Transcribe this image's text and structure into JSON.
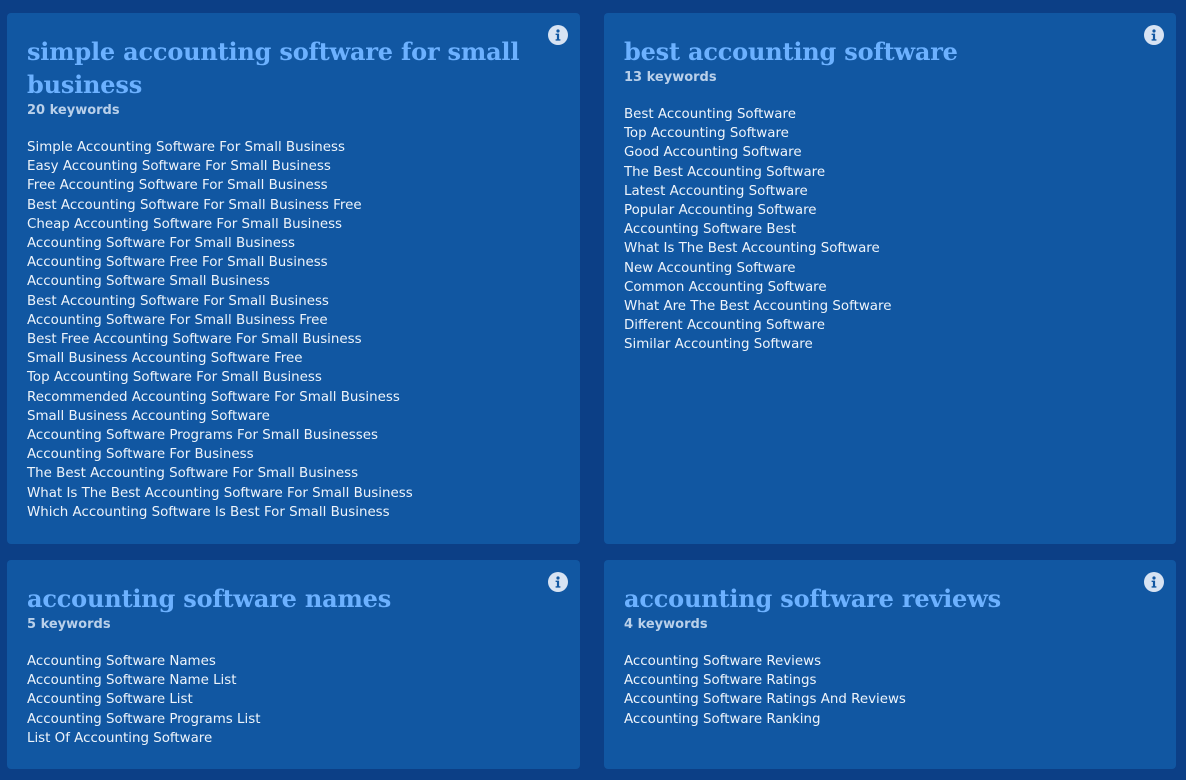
{
  "cards": [
    {
      "title": "simple accounting software for small business",
      "count": "20 keywords",
      "keywords": [
        "Simple Accounting Software For Small Business",
        "Easy Accounting Software For Small Business",
        "Free Accounting Software For Small Business",
        "Best Accounting Software For Small Business Free",
        "Cheap Accounting Software For Small Business",
        "Accounting Software For Small Business",
        "Accounting Software Free For Small Business",
        "Accounting Software Small Business",
        "Best Accounting Software For Small Business",
        "Accounting Software For Small Business Free",
        "Best Free Accounting Software For Small Business",
        "Small Business Accounting Software Free",
        "Top Accounting Software For Small Business",
        "Recommended Accounting Software For Small Business",
        "Small Business Accounting Software",
        "Accounting Software Programs For Small Businesses",
        "Accounting Software For Business",
        "The Best Accounting Software For Small Business",
        "What Is The Best Accounting Software For Small Business",
        "Which Accounting Software Is Best For Small Business"
      ]
    },
    {
      "title": "best accounting software",
      "count": "13 keywords",
      "keywords": [
        "Best Accounting Software",
        "Top Accounting Software",
        "Good Accounting Software",
        "The Best Accounting Software",
        "Latest Accounting Software",
        "Popular Accounting Software",
        "Accounting Software Best",
        "What Is The Best Accounting Software",
        "New Accounting Software",
        "Common Accounting Software",
        "What Are The Best Accounting Software",
        "Different Accounting Software",
        "Similar Accounting Software"
      ]
    },
    {
      "title": "accounting software names",
      "count": "5 keywords",
      "keywords": [
        "Accounting Software Names",
        "Accounting Software Name List",
        "Accounting Software List",
        "Accounting Software Programs List",
        "List Of Accounting Software"
      ]
    },
    {
      "title": "accounting software reviews",
      "count": "4 keywords",
      "keywords": [
        "Accounting Software Reviews",
        "Accounting Software Ratings",
        "Accounting Software Ratings And Reviews",
        "Accounting Software Ranking"
      ]
    }
  ],
  "icons": {
    "info": "info-icon"
  },
  "colors": {
    "page_background": "#0c3f86",
    "card_background": "#1157a2",
    "title": "#6cb1ff",
    "count": "#b9d0ea",
    "keyword": "#eef4fb",
    "info_icon_bg": "#d7e3f3",
    "info_icon_fg": "#1157a2"
  }
}
